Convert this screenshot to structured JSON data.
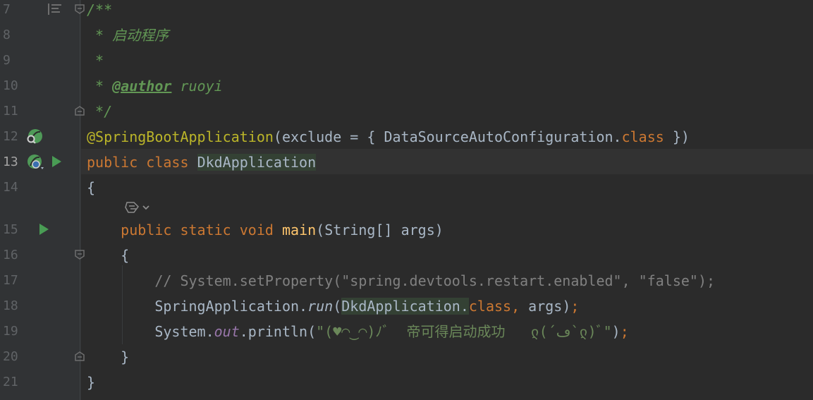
{
  "colors": {
    "background": "#2b2b2b",
    "gutter": "#313335",
    "keyword": "#cc7832",
    "doc_comment": "#629755",
    "annotation": "#bbb529",
    "string": "#6a8759",
    "line_comment": "#808080",
    "method_decl": "#ffc66d",
    "run_icon": "#499c54"
  },
  "icons": {
    "structure": "structure-icon",
    "fold": "fold-icon",
    "spring_bean": "spring-bean-icon",
    "run": "run-icon",
    "inlay_hint": "ai-hint-icon"
  },
  "editor": {
    "current_line": "13",
    "lines": [
      {
        "number": "7"
      },
      {
        "number": "8"
      },
      {
        "number": "9"
      },
      {
        "number": "10"
      },
      {
        "number": "11"
      },
      {
        "number": "12"
      },
      {
        "number": "13"
      },
      {
        "number": "14"
      },
      {
        "number": "15"
      },
      {
        "number": "16"
      },
      {
        "number": "17"
      },
      {
        "number": "18"
      },
      {
        "number": "19"
      },
      {
        "number": "20"
      },
      {
        "number": "21"
      }
    ],
    "tokens": {
      "l7_doc_open": "/**",
      "l8_star": " * ",
      "l8_text": "启动程序",
      "l9_star": " *",
      "l10_star": " * ",
      "l10_tag": "@author",
      "l10_value": " ruoyi",
      "l11_close": " */",
      "l12_annotation": "@SpringBootApplication",
      "l12_args_open": "(exclude = { DataSourceAutoConfiguration.",
      "l12_class_kw": "class",
      "l12_args_close": " })",
      "l13_public": "public",
      "l13_class": "class",
      "l13_name": "DkdApplication",
      "l14_brace": "{",
      "l15_public": "public",
      "l15_static": "static",
      "l15_void": "void",
      "l15_main": "main",
      "l15_params": "(String[] args)",
      "l16_brace": "{",
      "l17_comment": "// System.setProperty(\"spring.devtools.restart.enabled\", \"false\");",
      "l18_start": "SpringApplication.",
      "l18_run": "run",
      "l18_open": "(",
      "l18_arg": "DkdApplication.",
      "l18_class_kw": "class",
      "l18_comma": ",",
      "l18_args": " args)",
      "l18_semi": ";",
      "l19_start": "System.",
      "l19_out": "out",
      "l19_println": ".println(",
      "l19_string": "\"(♥◠‿◠)ﾉﾞ  帝可得启动成功   ლ(´ڡ`ლ)ﾞ\"",
      "l19_close": ")",
      "l19_semi": ";",
      "l20_brace": "}",
      "l21_brace": "}"
    }
  }
}
